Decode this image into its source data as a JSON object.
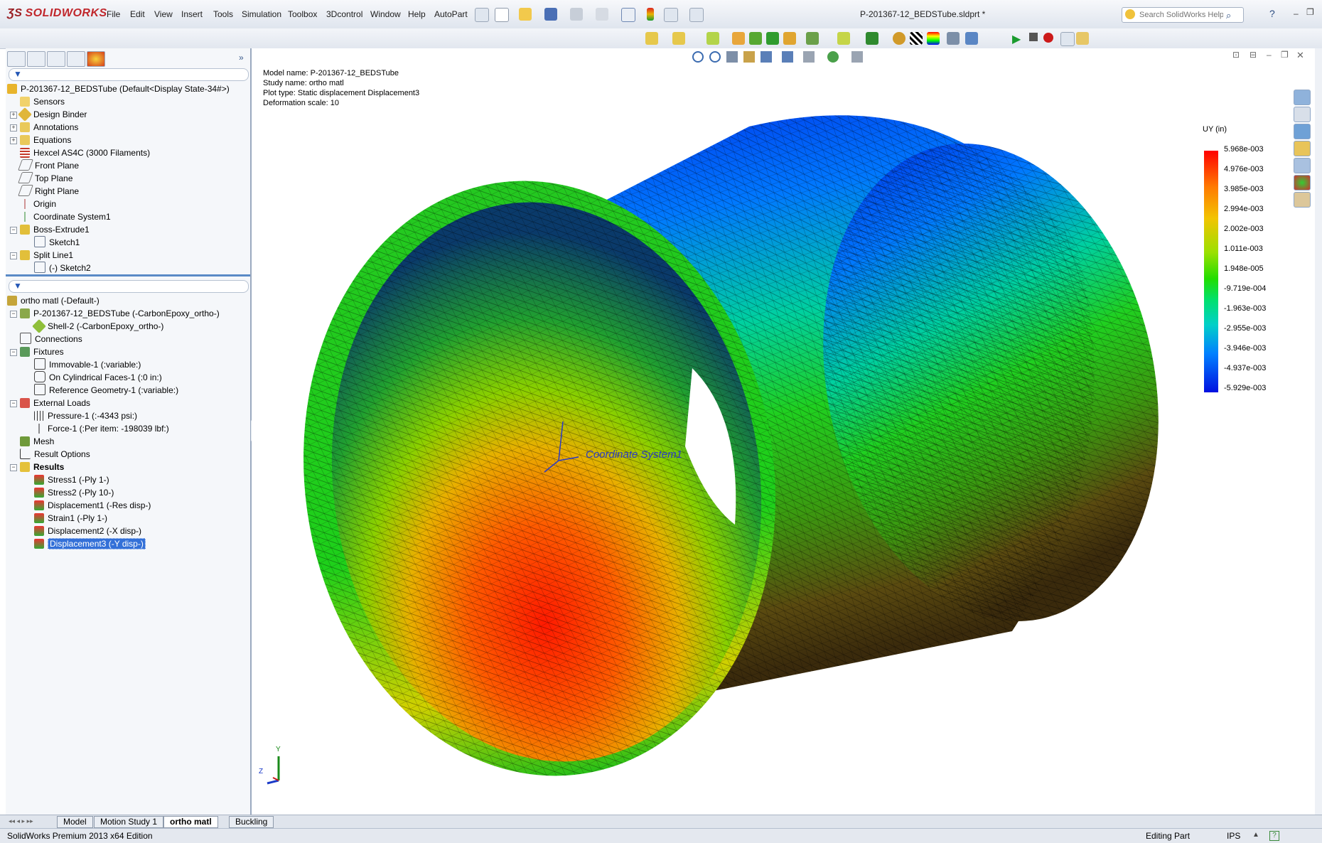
{
  "app": {
    "logo_text": "SOLIDWORKS",
    "document_title": "P-201367-12_BEDSTube.sldprt *",
    "menu": [
      "File",
      "Edit",
      "View",
      "Insert",
      "Tools",
      "Simulation",
      "Toolbox",
      "3Dcontrol",
      "Window",
      "Help",
      "AutoPart"
    ],
    "help_search_placeholder": "Search SolidWorks Help"
  },
  "feature_tree": {
    "root": "P-201367-12_BEDSTube  (Default<Display State-34#>)",
    "items": [
      {
        "label": "Sensors"
      },
      {
        "label": "Design Binder"
      },
      {
        "label": "Annotations"
      },
      {
        "label": "Equations"
      },
      {
        "label": "Hexcel AS4C (3000 Filaments)"
      },
      {
        "label": "Front Plane"
      },
      {
        "label": "Top Plane"
      },
      {
        "label": "Right Plane"
      },
      {
        "label": "Origin"
      },
      {
        "label": "Coordinate System1"
      },
      {
        "label": "Boss-Extrude1"
      },
      {
        "label": "Sketch1"
      },
      {
        "label": "Split Line1"
      },
      {
        "label": "(-) Sketch2"
      }
    ]
  },
  "study_tree": {
    "root": "ortho matl (-Default-)",
    "items": [
      {
        "label": "P-201367-12_BEDSTube (-CarbonEpoxy_ortho-)"
      },
      {
        "label": "Shell-2 (-CarbonEpoxy_ortho-)"
      },
      {
        "label": "Connections"
      },
      {
        "label": "Fixtures"
      },
      {
        "label": "Immovable-1 (:variable:)"
      },
      {
        "label": "On Cylindrical Faces-1 (:0 in:)"
      },
      {
        "label": "Reference Geometry-1 (:variable:)"
      },
      {
        "label": "External Loads"
      },
      {
        "label": "Pressure-1 (:-4343 psi:)"
      },
      {
        "label": "Force-1 (:Per item: -198039 lbf:)"
      },
      {
        "label": "Mesh"
      },
      {
        "label": "Result Options"
      },
      {
        "label": "Results"
      },
      {
        "label": "Stress1 (-Ply 1-)"
      },
      {
        "label": "Stress2 (-Ply 10-)"
      },
      {
        "label": "Displacement1 (-Res disp-)"
      },
      {
        "label": "Strain1 (-Ply 1-)"
      },
      {
        "label": "Displacement2 (-X disp-)"
      },
      {
        "label": "Displacement3 (-Y disp-)"
      }
    ]
  },
  "plot_info": {
    "model_name": "Model name: P-201367-12_BEDSTube",
    "study_name": "Study name: ortho matl",
    "plot_type": "Plot type: Static displacement Displacement3",
    "deformation_scale": "Deformation scale: 10"
  },
  "legend": {
    "title": "UY (in)",
    "values": [
      "5.968e-003",
      "4.976e-003",
      "3.985e-003",
      "2.994e-003",
      "2.002e-003",
      "1.011e-003",
      "1.948e-005",
      "-9.719e-004",
      "-1.963e-003",
      "-2.955e-003",
      "-3.946e-003",
      "-4.937e-003",
      "-5.929e-003"
    ]
  },
  "viewport": {
    "coordinate_label": "Coordinate System1",
    "triad_y": "Y",
    "triad_z": "Z"
  },
  "bottom_tabs": [
    "Model",
    "Motion Study 1",
    "ortho matl",
    "Buckling"
  ],
  "status": {
    "edition": "SolidWorks Premium 2013 x64 Edition",
    "mode": "Editing Part",
    "units": "IPS"
  }
}
